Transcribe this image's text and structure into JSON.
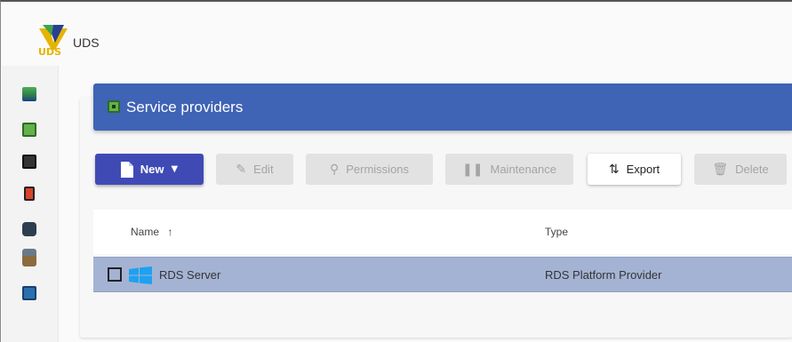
{
  "app": {
    "title": "UDS",
    "logo_text": "UDS"
  },
  "sidebar": {
    "icons": [
      {
        "name": "dashboard-icon",
        "color": "#2d7a4f"
      },
      {
        "name": "service-providers-icon",
        "color": "#4caf50"
      },
      {
        "name": "authenticators-icon",
        "color": "#333333"
      },
      {
        "name": "os-managers-icon",
        "color": "#d9442b"
      },
      {
        "name": "connectivity-icon",
        "color": "#2c3e50"
      },
      {
        "name": "pools-icon",
        "color": "#8c6b3e"
      },
      {
        "name": "calendars-icon",
        "color": "#2a6fb0"
      }
    ]
  },
  "panel": {
    "title": "Service providers"
  },
  "toolbar": {
    "new_label": "New",
    "edit_label": "Edit",
    "permissions_label": "Permissions",
    "maintenance_label": "Maintenance",
    "export_label": "Export",
    "delete_label": "Delete"
  },
  "table": {
    "columns": {
      "name": "Name",
      "type": "Type"
    },
    "sort_indicator": "↑",
    "rows": [
      {
        "name": "RDS Server",
        "type": "RDS Platform Provider"
      }
    ]
  },
  "colors": {
    "header": "#3f63b5",
    "primary_button": "#3f4ab5",
    "selected_row": "#a4b3d3"
  }
}
